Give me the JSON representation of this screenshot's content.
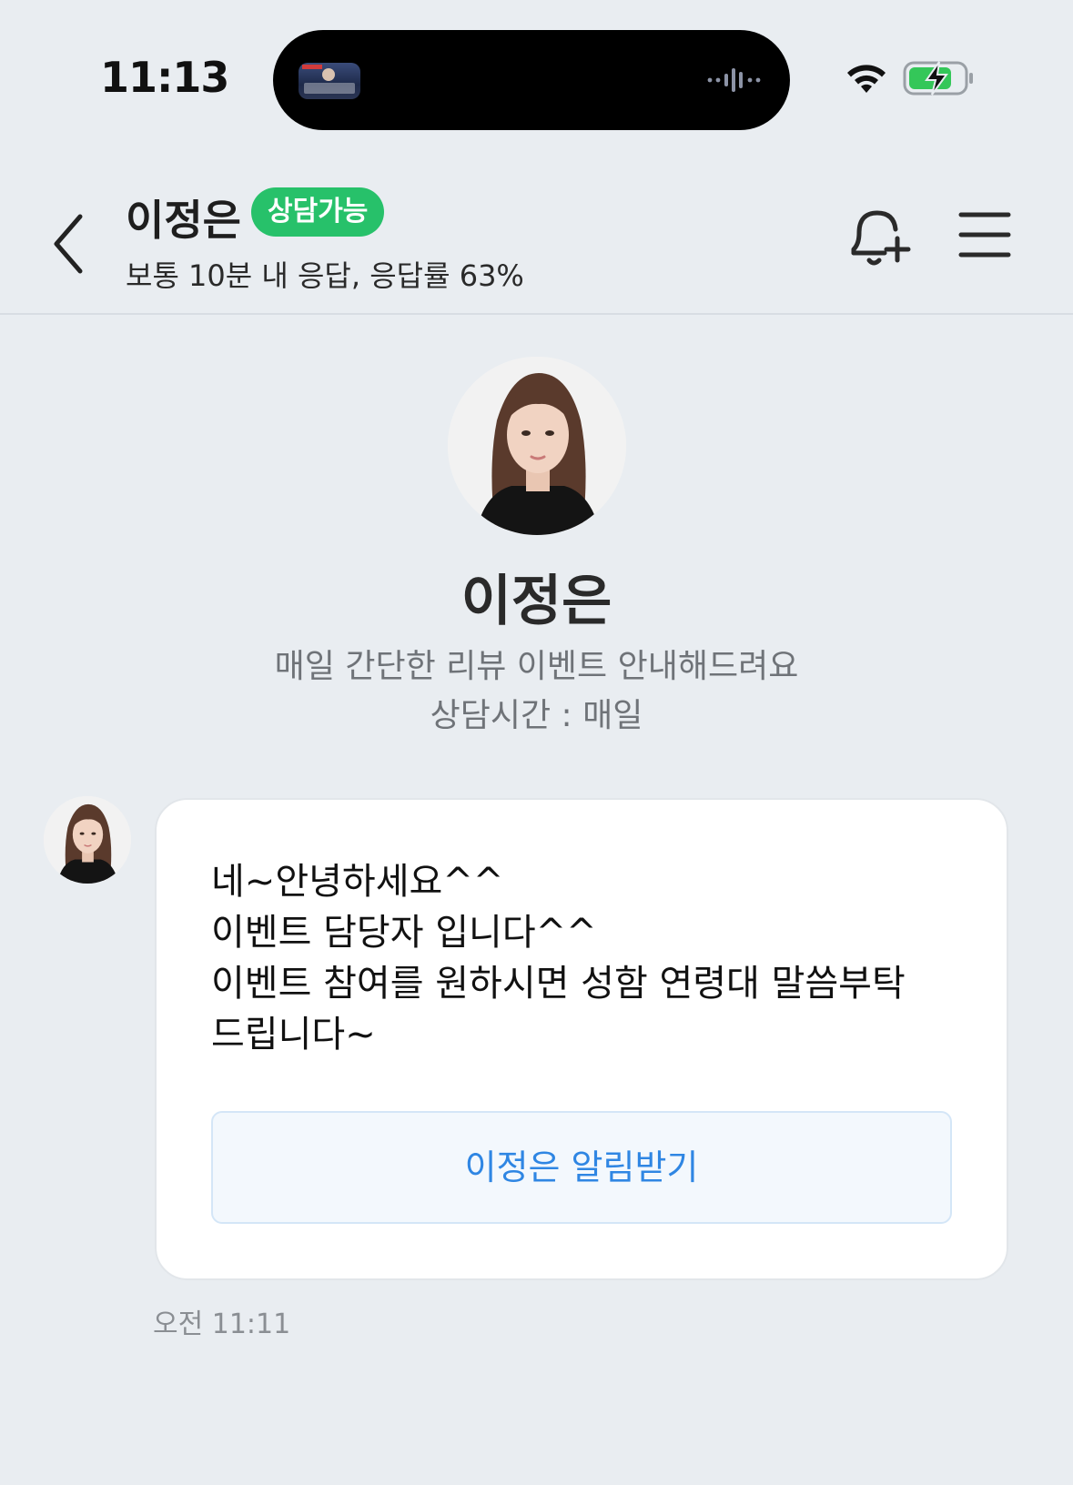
{
  "status_bar": {
    "time": "11:13",
    "wifi_icon": "wifi-icon",
    "battery_icon": "battery-charging-icon",
    "battery_color": "#34c759"
  },
  "header": {
    "back_icon": "chevron-left-icon",
    "name": "이정은",
    "badge": "상담가능",
    "badge_color": "#27c16a",
    "subtitle": "보통 10분 내 응답, 응답률 63%",
    "bell_icon": "bell-plus-icon",
    "menu_icon": "hamburger-menu-icon"
  },
  "profile": {
    "name": "이정은",
    "description_line1": "매일 간단한 리뷰 이벤트 안내해드려요",
    "description_line2": "상담시간 : 매일"
  },
  "message": {
    "lines": [
      "네~안녕하세요^^",
      "이벤트 담당자 입니다^^",
      "이벤트 참여를 원하시면 성함 연령대 말씀부탁",
      "드립니다~"
    ],
    "button_label": "이정은 알림받기",
    "button_color": "#2f86e3",
    "time": "오전 11:11"
  }
}
